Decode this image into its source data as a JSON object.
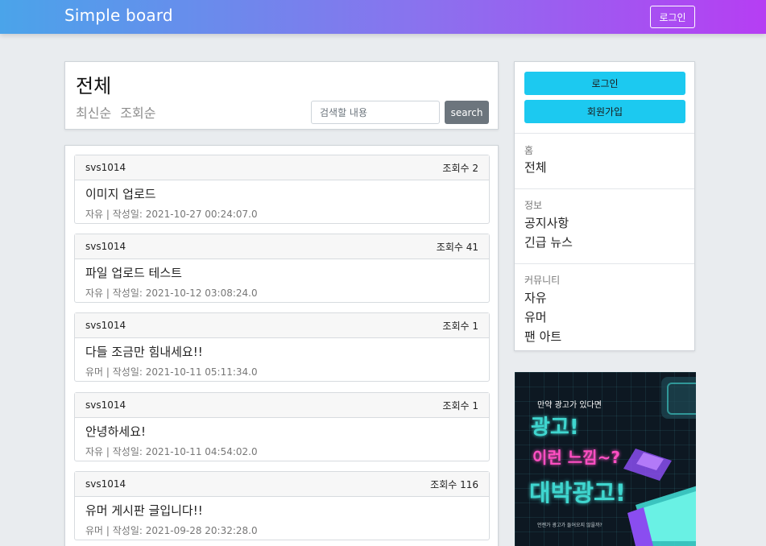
{
  "navbar": {
    "brand": "Simple board",
    "login_label": "로그인"
  },
  "board": {
    "title": "전체",
    "sort_options": [
      "최신순",
      "조회순"
    ],
    "search_placeholder": "검색할 내용",
    "search_label": "search"
  },
  "posts": [
    {
      "author": "svs1014",
      "views": "조회수 2",
      "title": "이미지 업로드",
      "meta": "자유 | 작성일: 2021-10-27 00:24:07.0"
    },
    {
      "author": "svs1014",
      "views": "조회수 41",
      "title": "파일 업로드 테스트",
      "meta": "자유 | 작성일: 2021-10-12 03:08:24.0"
    },
    {
      "author": "svs1014",
      "views": "조회수 1",
      "title": "다들 조금만 힘내세요!!",
      "meta": "유머 | 작성일: 2021-10-11 05:11:34.0"
    },
    {
      "author": "svs1014",
      "views": "조회수 1",
      "title": "안녕하세요!",
      "meta": "자유 | 작성일: 2021-10-11 04:54:02.0"
    },
    {
      "author": "svs1014",
      "views": "조회수 116",
      "title": "유머 게시판 글입니다!!",
      "meta": "유머 | 작성일: 2021-09-28 20:32:28.0"
    }
  ],
  "sidebar": {
    "login_label": "로그인",
    "signup_label": "회원가입",
    "sections": [
      {
        "label": "홈",
        "links": [
          "전체"
        ]
      },
      {
        "label": "정보",
        "links": [
          "공지사항",
          "긴급 뉴스"
        ]
      },
      {
        "label": "커뮤니티",
        "links": [
          "자유",
          "유머",
          "팬 아트"
        ]
      }
    ]
  },
  "ad": {
    "line1": "만약 광고가 있다면",
    "line2": "광고!",
    "line3": "이런 느낌~?",
    "line4": "대박광고!",
    "line5": "언젠가 광고가 들어오지 않을까?",
    "colors": {
      "bg": "#0d1822",
      "teal": "#3fd6cf",
      "pink": "#ff4fc3",
      "purple": "#8a4df0"
    }
  },
  "colors": {
    "nav_start": "#4aa4ea",
    "nav_end": "#b63ef3",
    "sidebar_button": "#1cc9f0",
    "search_button": "#6c757d",
    "page_bg": "#e9ecef"
  }
}
